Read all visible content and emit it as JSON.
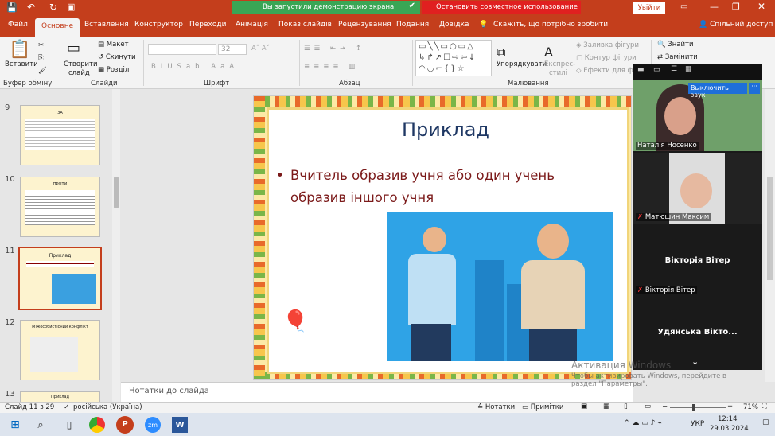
{
  "titlebar": {
    "share_notice": "Вы запустили демонстрацию экрана",
    "stop_share": "Остановить совместное использование",
    "signin": "Увійти"
  },
  "tabs": [
    "Файл",
    "Основне",
    "Вставлення",
    "Конструктор",
    "Переходи",
    "Анімація",
    "Показ слайдів",
    "Рецензування",
    "Подання",
    "Довідка"
  ],
  "tell_me": "Скажіть, що потрібно зробити",
  "share_btn": "Спільний доступ",
  "ribbon": {
    "paste": "Вставити",
    "clipboard": "Буфер обміну",
    "new_slide_line1": "Створити",
    "new_slide_line2": "слайд",
    "layout": "Макет",
    "reset": "Скинути",
    "section": "Розділ",
    "slides": "Слайди",
    "font_size": "32",
    "font": "Шрифт",
    "paragraph": "Абзац",
    "arrange": "Упорядкувати",
    "express_line1": "Експрес-",
    "express_line2": "стилі",
    "drawing": "Малювання",
    "fill": "Заливка фігури",
    "outline": "Контур фігури",
    "effects": "Ефекти для фігур",
    "find": "Знайти",
    "replace": "Замінити"
  },
  "thumbnails": [
    {
      "num": "9",
      "title": "ЗА"
    },
    {
      "num": "10",
      "title": "ПРОТИ"
    },
    {
      "num": "11",
      "title": "Приклад"
    },
    {
      "num": "12",
      "title": "Міжособистісний конфлікт"
    },
    {
      "num": "13",
      "title": "Приклад"
    }
  ],
  "slide": {
    "title": "Приклад",
    "bullet": "Вчитель образив учня або один учень образив іншого учня"
  },
  "notes_placeholder": "Нотатки до слайда",
  "video": {
    "mute_btn": "Выключить звук",
    "p1": "Наталія Носенко",
    "p2": "Матюшин Максим",
    "p3_center": "Вікторія Вітер",
    "p3": "Вікторія Вітер",
    "p4_center": "Удянська Вікто..."
  },
  "watermark": {
    "line1": "Активация Windows",
    "line2": "Чтобы активировать Windows, перейдите в",
    "line3": "раздел \"Параметры\"."
  },
  "status": {
    "slide": "Слайд 11 з 29",
    "lang": "російська (Україна)",
    "notes": "Нотатки",
    "comments": "Примітки",
    "zoom": "71%"
  },
  "taskbar": {
    "lang": "УКР",
    "time": "12:14",
    "date": "29.03.2024"
  },
  "colors": {
    "accent": "#c43e1c",
    "slide_title": "#1f3864",
    "bullet": "#7b1a1a"
  }
}
